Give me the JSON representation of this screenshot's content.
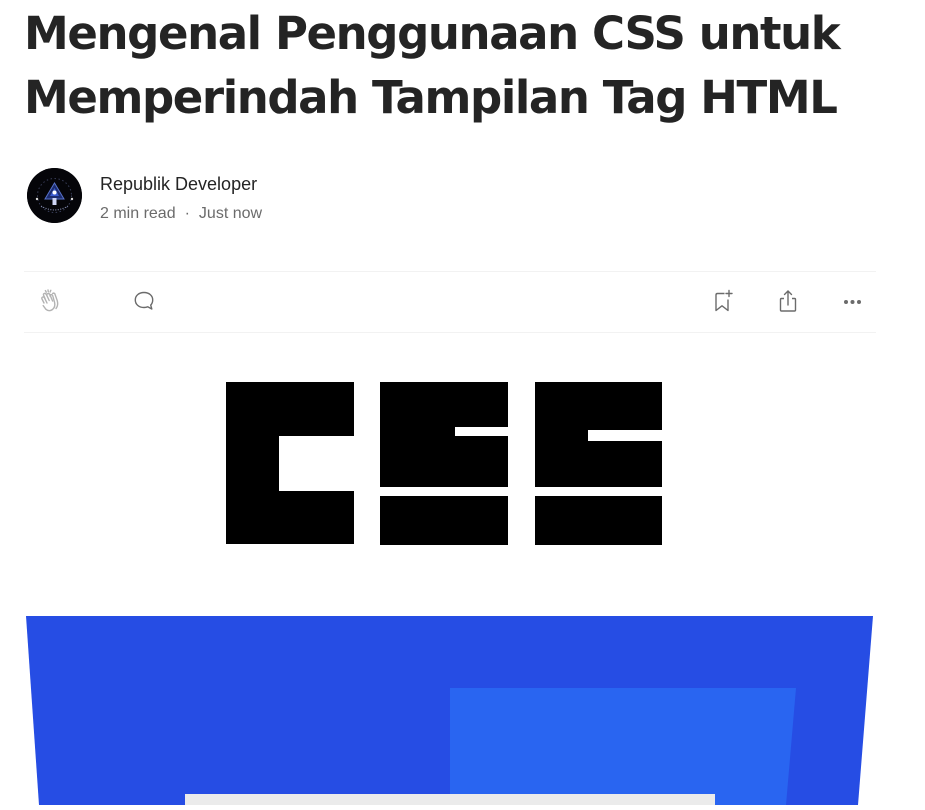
{
  "article": {
    "title": "Mengenal Penggunaan CSS untuk Memperindah Tampilan Tag HTML",
    "author": {
      "name": "Republik Developer",
      "read_time": "2 min read",
      "separator": "·",
      "published": "Just now"
    }
  },
  "actions": {
    "left": [
      {
        "name": "clap",
        "icon": "clap-icon"
      },
      {
        "name": "comment",
        "icon": "comment-icon"
      }
    ],
    "right": [
      {
        "name": "bookmark",
        "icon": "bookmark-add-icon"
      },
      {
        "name": "share",
        "icon": "share-icon"
      },
      {
        "name": "more",
        "icon": "more-horizontal-icon"
      }
    ]
  },
  "images": [
    {
      "name": "css-logo-image",
      "text": "CSS"
    },
    {
      "name": "css-shield-image"
    }
  ],
  "colors": {
    "text_primary": "#242424",
    "text_secondary": "#6b6b6b",
    "divider": "#f2f2f2",
    "brand_blue": "#264de4",
    "brand_blue_light": "#2965f1"
  }
}
